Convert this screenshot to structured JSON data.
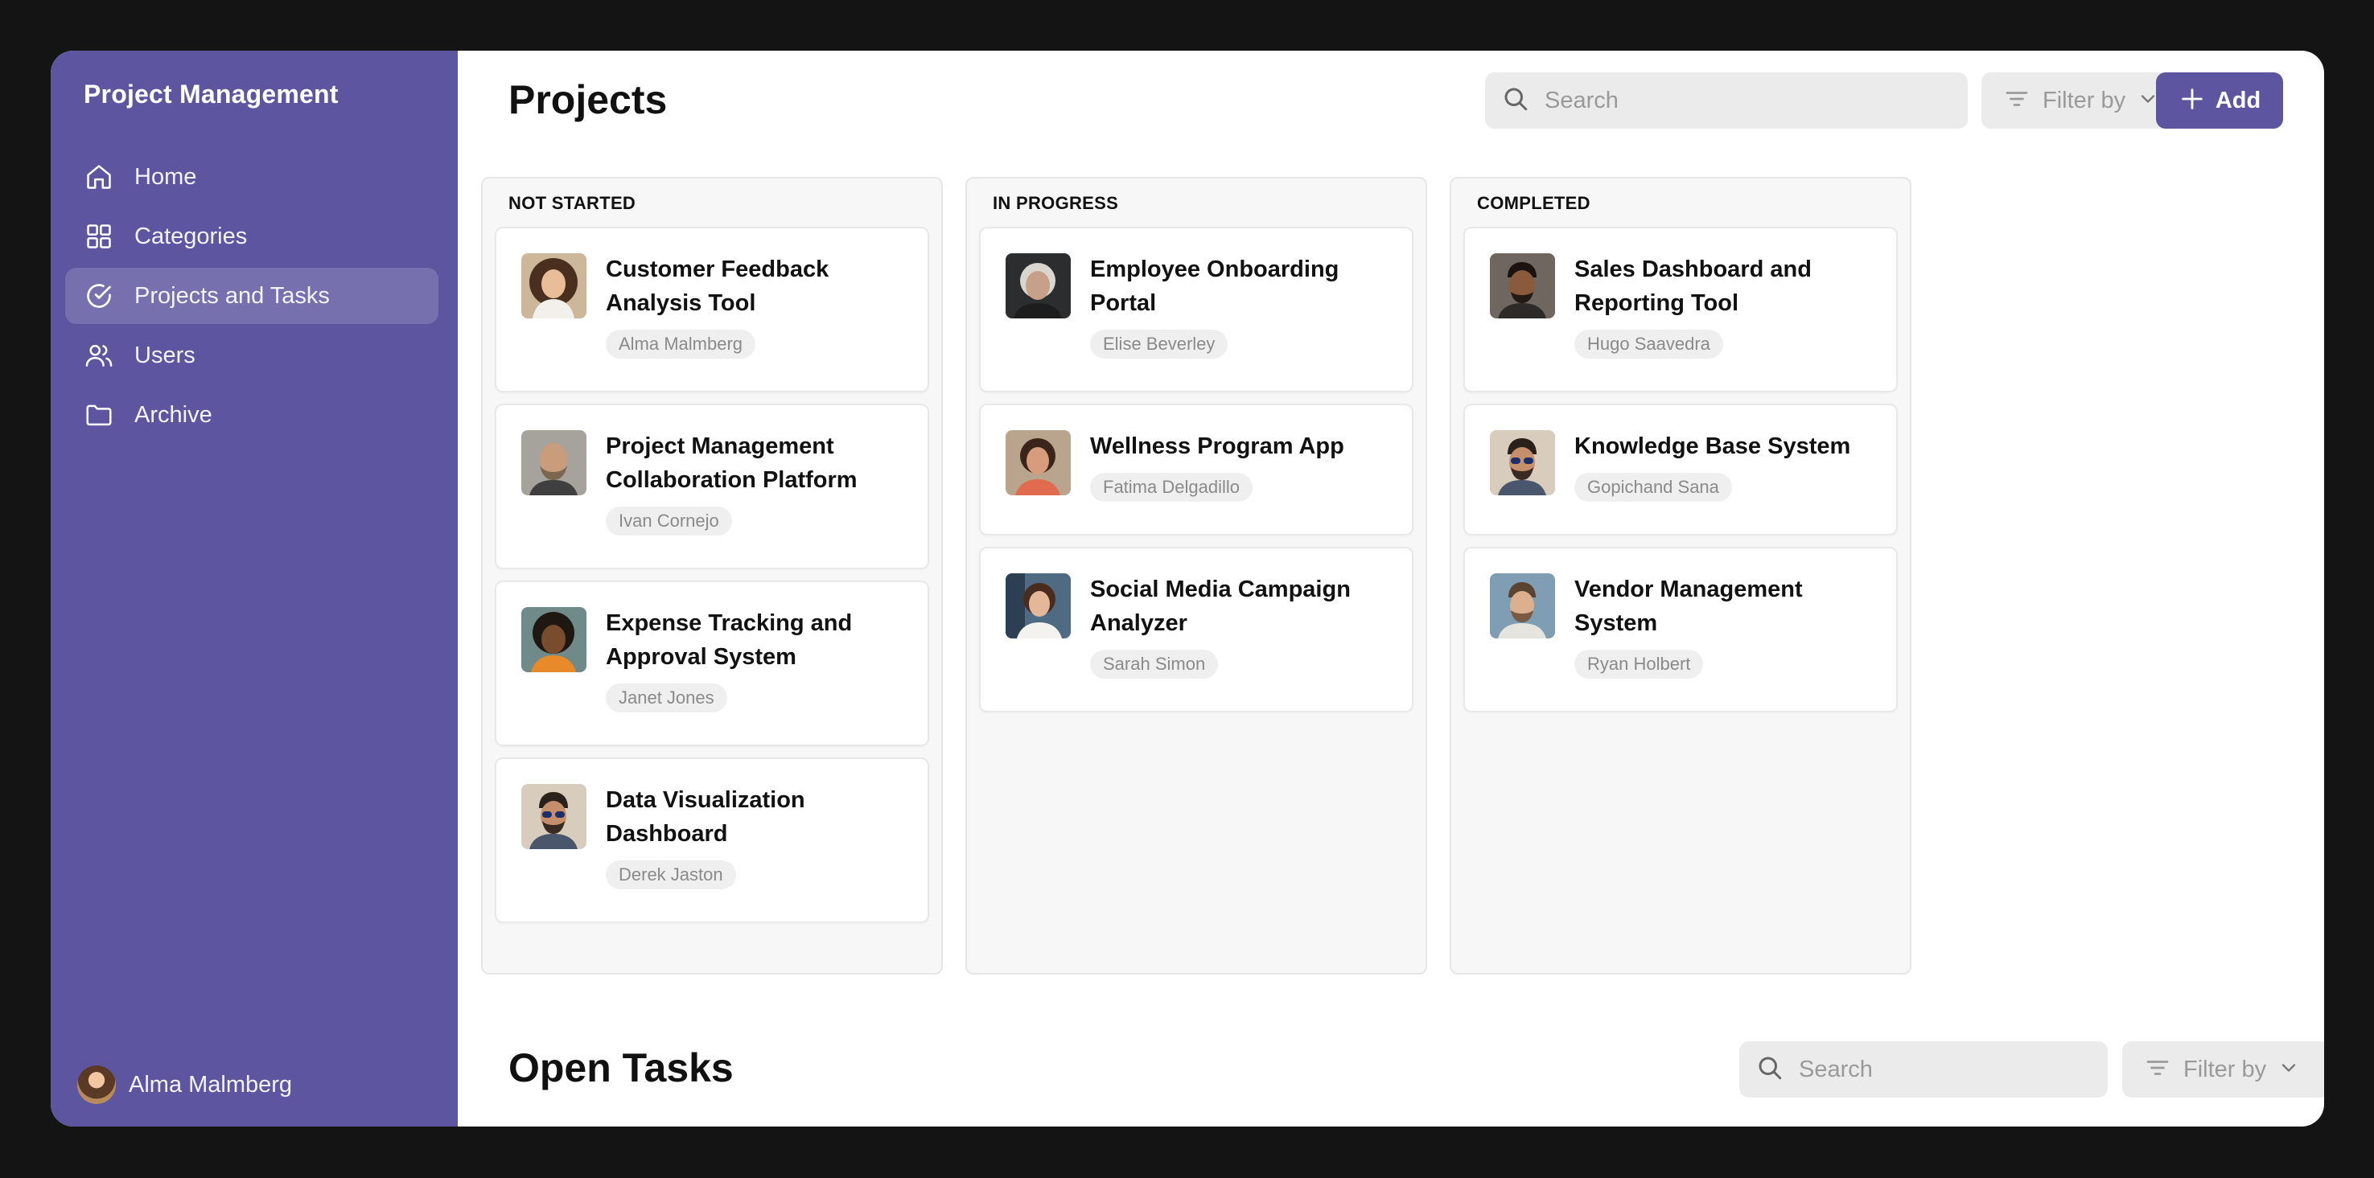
{
  "sidebar": {
    "title": "Project Management",
    "items": [
      {
        "label": "Home",
        "icon": "home-icon"
      },
      {
        "label": "Categories",
        "icon": "grid-icon"
      },
      {
        "label": "Projects and Tasks",
        "icon": "check-circle-icon",
        "active": true
      },
      {
        "label": "Users",
        "icon": "users-icon"
      },
      {
        "label": "Archive",
        "icon": "folder-icon"
      }
    ],
    "user": {
      "name": "Alma Malmberg"
    }
  },
  "projects": {
    "title": "Projects",
    "search_placeholder": "Search",
    "filter_label": "Filter by",
    "add_label": "Add",
    "columns": [
      {
        "title": "NOT STARTED",
        "cards": [
          {
            "title": "Customer Feedback Analysis Tool",
            "owner": "Alma Malmberg"
          },
          {
            "title": "Project Management Collaboration Platform",
            "owner": "Ivan Cornejo"
          },
          {
            "title": "Expense Tracking and Approval System",
            "owner": "Janet Jones"
          },
          {
            "title": "Data Visualization Dashboard",
            "owner": "Derek Jaston"
          }
        ]
      },
      {
        "title": "IN PROGRESS",
        "cards": [
          {
            "title": "Employee Onboarding Portal",
            "owner": "Elise Beverley"
          },
          {
            "title": "Wellness Program App",
            "owner": "Fatima Delgadillo"
          },
          {
            "title": "Social Media Campaign Analyzer",
            "owner": "Sarah Simon"
          }
        ]
      },
      {
        "title": "COMPLETED",
        "cards": [
          {
            "title": "Sales Dashboard and Reporting Tool",
            "owner": "Hugo Saavedra"
          },
          {
            "title": "Knowledge Base System",
            "owner": "Gopichand Sana"
          },
          {
            "title": "Vendor Management System",
            "owner": "Ryan Holbert"
          }
        ]
      }
    ]
  },
  "tasks": {
    "title": "Open Tasks",
    "search_placeholder": "Search",
    "filter_label": "Filter by"
  },
  "colors": {
    "sidebar": "#5d559f",
    "accent": "#5d559f",
    "background": "#141414"
  }
}
